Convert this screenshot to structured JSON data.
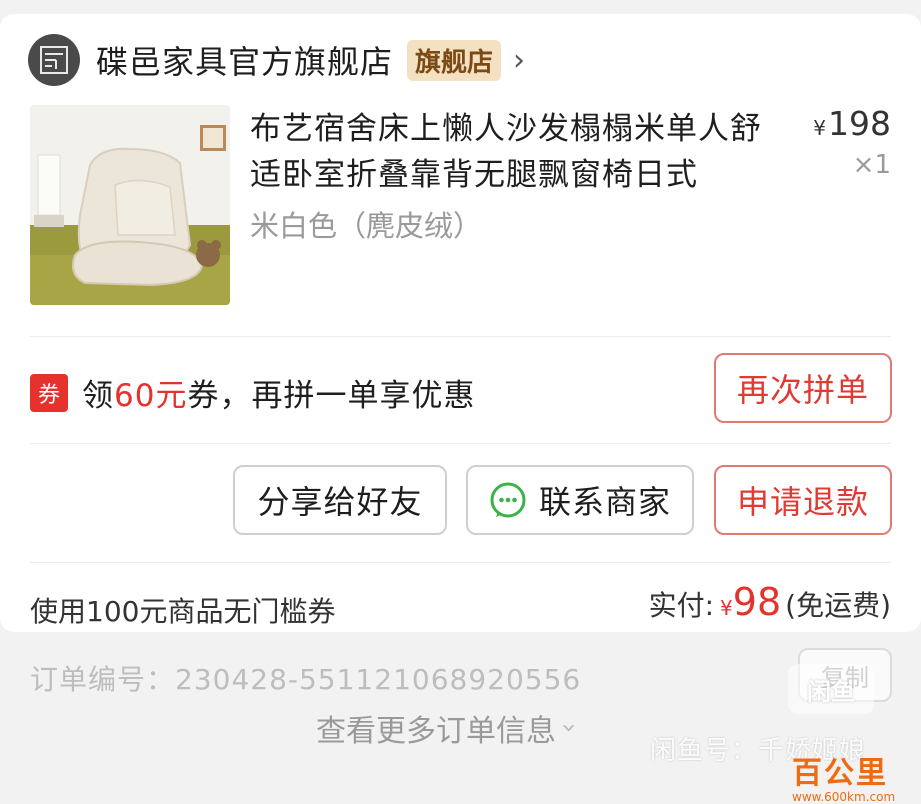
{
  "shop": {
    "name": "碟邑家具官方旗舰店",
    "badge": "旗舰店",
    "chevron": "›"
  },
  "product": {
    "title": "布艺宿舍床上懒人沙发榻榻米单人舒适卧室折叠靠背无腿飘窗椅日式",
    "variant": "米白色（麂皮绒）",
    "price_symbol": "¥",
    "price": "198",
    "quantity": "×1"
  },
  "coupon": {
    "tag": "券",
    "text_prefix": "领",
    "amount": "60元",
    "text_suffix": "券，再拼一单享优惠"
  },
  "buttons": {
    "regroup": "再次拼单",
    "share": "分享给好友",
    "contact": "联系商家",
    "refund": "申请退款",
    "copy": "复制"
  },
  "summary": {
    "coupon_used": "使用100元商品无门槛券",
    "paid_label": "实付:",
    "paid_symbol": "¥",
    "paid_amount": "98",
    "shipping": "(免运费)"
  },
  "order": {
    "number_text": "订单编号：230428-551121068920556",
    "more_info": "查看更多订单信息"
  },
  "watermarks": {
    "xianyu_badge": "闲鱼",
    "xianyu_id": "闲鱼号：千娇姬娘",
    "site_name": "百公里",
    "site_url": "www.600km.com"
  },
  "colors": {
    "accent_red": "#e5322d",
    "badge_bg": "#f4e1c2",
    "wechat_green": "#3bb34a"
  },
  "icons": {
    "shop_logo": "shop-logo-icon",
    "wechat": "wechat-icon",
    "chevron_right": "chevron-right-icon",
    "chevron_down": "chevron-down-icon"
  }
}
